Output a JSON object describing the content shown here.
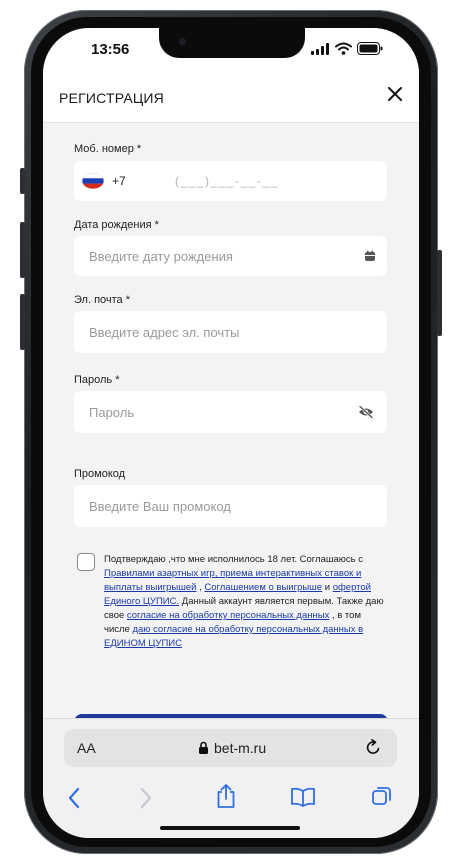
{
  "status_bar": {
    "time": "13:56"
  },
  "header": {
    "title": "РЕГИСТРАЦИЯ"
  },
  "form": {
    "phone": {
      "label": "Моб. номер *",
      "prefix": "+7",
      "mask": "(___)___-__-__"
    },
    "birth": {
      "label": "Дата рождения *",
      "placeholder": "Введите дату рождения"
    },
    "email": {
      "label": "Эл. почта *",
      "placeholder": "Введите адрес эл. почты"
    },
    "password": {
      "label": "Пароль *",
      "placeholder": "Пароль"
    },
    "promo": {
      "label": "Промокод",
      "placeholder": "Введите Ваш промокод"
    }
  },
  "consent": {
    "t1": "Подтверждаю ,что мне исполнилось 18 лет. Соглашаюсь с ",
    "l1": "Правилами азартных игр, приема интерактивных ставок и выплаты выигрышей",
    "t2": " , ",
    "l2": "Соглашением о выигрыше",
    "t3": "  и ",
    "l3": "офертой Единого ЦУПИС.",
    "t4": " Данный аккаунт является первым. Также даю свое ",
    "l4": "согласие на обработку персональных данных",
    "t5": " , в том числе ",
    "l5": "даю согласие на обработку персональных данных в ЕДИНОМ ЦУПИС"
  },
  "browser": {
    "text_size": "AA",
    "url": "bet-m.ru"
  },
  "colors": {
    "accent": "#1f3a9a",
    "link": "#1a3aa8",
    "ios_blue": "#2f6fe0"
  }
}
